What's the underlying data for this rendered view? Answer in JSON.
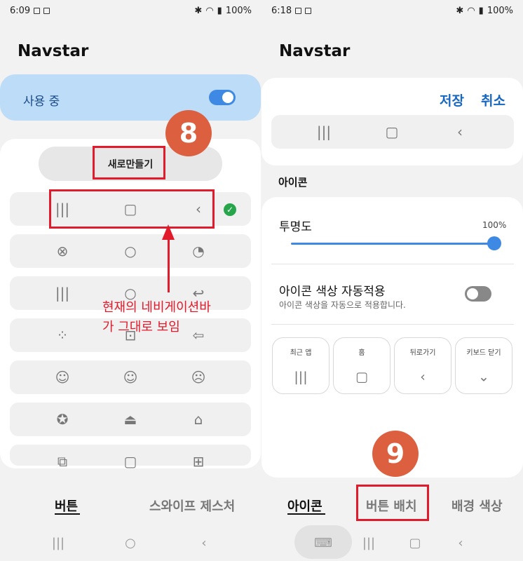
{
  "left": {
    "status": {
      "time": "6:09",
      "battery": "100%"
    },
    "app_title": "Navstar",
    "in_use_label": "사용 중",
    "new_button": "새로만들기",
    "rows": [
      [
        "|||",
        "▢",
        "‹"
      ],
      [
        "⊗",
        "○",
        "◔"
      ],
      [
        "|||",
        "○",
        "↩"
      ],
      [
        "⁘",
        "⊡",
        "⇦"
      ],
      [
        "☺",
        "☺",
        "☹"
      ],
      [
        "✪",
        "⏏",
        "⌂"
      ],
      [
        "⧉",
        "▢",
        "⊞"
      ]
    ],
    "check_mark": "✓",
    "annotation_line1": "현재의 네비게이션바",
    "annotation_line2": "가 그대로 보임",
    "badge": "8",
    "tabs": {
      "buttons": "버튼",
      "swipe": "스와이프 제스처"
    },
    "nav": {
      "recent": "|||",
      "home": "○",
      "back": "‹"
    }
  },
  "right": {
    "status": {
      "time": "6:18",
      "battery": "100%"
    },
    "app_title": "Navstar",
    "save": "저장",
    "cancel": "취소",
    "preview": {
      "recent": "|||",
      "home": "▢",
      "back": "‹"
    },
    "section_icon": "아이콘",
    "opacity": {
      "label": "투명도",
      "value": "100%",
      "fraction": 1.0
    },
    "auto_color": {
      "title": "아이콘 색상 자동적용",
      "desc": "아이콘 색상을 자동으로 적용합니다."
    },
    "keys": [
      {
        "label": "최근 앱",
        "icon": "|||"
      },
      {
        "label": "홈",
        "icon": "▢"
      },
      {
        "label": "뒤로가기",
        "icon": "‹"
      },
      {
        "label": "키보드 닫기",
        "icon": "⌄"
      }
    ],
    "badge": "9",
    "tabs": {
      "icon": "아이콘",
      "layout": "버튼 배치",
      "bg": "배경 색상"
    },
    "nav": {
      "keyboard": "⌨",
      "recent": "|||",
      "home": "▢",
      "back": "‹"
    }
  }
}
